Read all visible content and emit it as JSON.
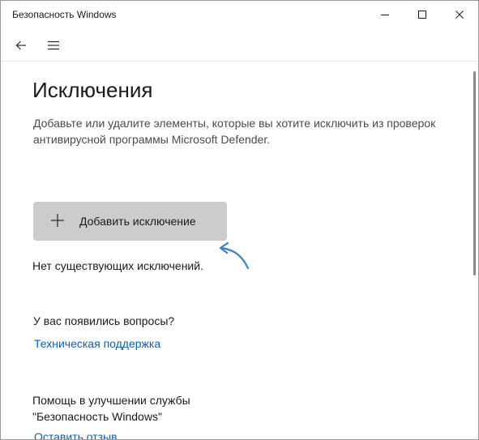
{
  "window": {
    "title": "Безопасность Windows"
  },
  "titlebar_icons": {
    "minimize": "minimize-icon",
    "maximize": "maximize-icon",
    "close": "close-icon"
  },
  "nav": {
    "back_icon": "back-arrow-icon",
    "menu_icon": "hamburger-menu-icon"
  },
  "page": {
    "title": "Исключения",
    "description": "Добавьте или удалите элементы, которые вы хотите исключить из проверок антивирусной программы Microsoft Defender.",
    "add_button_label": "Добавить исключение",
    "add_button_icon": "plus-icon",
    "no_exclusions_text": "Нет существующих исключений.",
    "questions_title": "У вас появились вопросы?",
    "support_link": "Техническая поддержка",
    "improve_title_line1": "Помощь в улучшении службы",
    "improve_title_line2": "\"Безопасность Windows\"",
    "feedback_link": "Оставить отзыв"
  },
  "colors": {
    "accent": "#0b5fb0",
    "annotation_arrow": "#3a7fc1",
    "button_bg": "#cccccc"
  }
}
